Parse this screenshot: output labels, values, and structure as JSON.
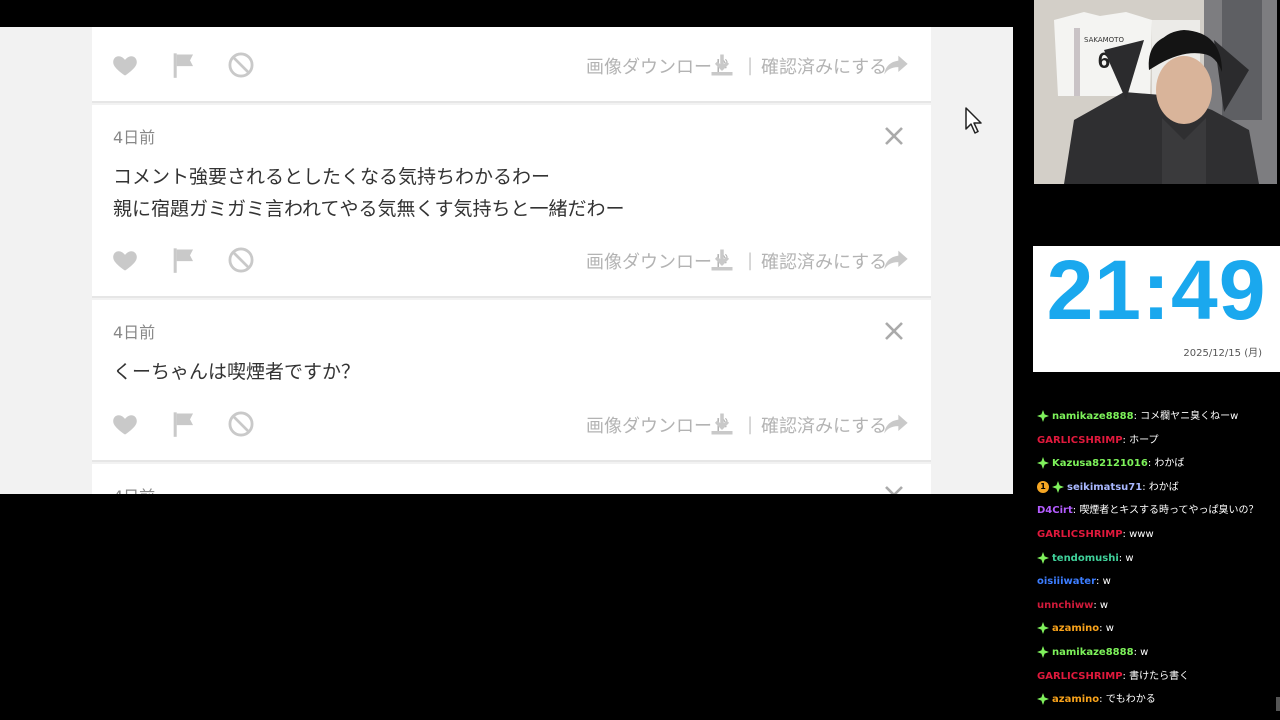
{
  "feed": {
    "actions": {
      "download_label": "画像ダウンロード",
      "separator": "|",
      "confirm_label": "確認済みにする"
    },
    "comments": [
      {
        "date": "",
        "lines": []
      },
      {
        "date": "4日前",
        "lines": [
          "コメント強要されるとしたくなる気持ちわかるわー",
          "親に宿題ガミガミ言われてやる気無くす気持ちと一緒だわー"
        ]
      },
      {
        "date": "4日前",
        "lines": [
          "くーちゃんは喫煙者ですか？"
        ]
      },
      {
        "date": "4日前",
        "lines": []
      }
    ]
  },
  "clock": {
    "time": "21:49",
    "date": "2025/12/15 (月)",
    "color": "#1aa8ee"
  },
  "webcam": {
    "jersey_name": "SAKAMOTO",
    "jersey_number": "6"
  },
  "chat": {
    "messages": [
      {
        "user": "namikaze8888",
        "color": "#7df25a",
        "badge": "diamond",
        "text": "コメ欄ヤニ臭くねーw"
      },
      {
        "user": "GARLICSHRIMP",
        "color": "#e0193c",
        "badge": "",
        "text": "ホープ"
      },
      {
        "user": "Kazusa82121016",
        "color": "#7df25a",
        "badge": "diamond",
        "text": "わかば"
      },
      {
        "user": "seikimatsu71",
        "color": "#a9b8ff",
        "badge": "coin-diamond",
        "coin": "1",
        "text": "わかば"
      },
      {
        "user": "D4Cirt",
        "color": "#b45cff",
        "badge": "",
        "text": "喫煙者とキスする時ってやっぱ臭いの？"
      },
      {
        "user": "GARLICSHRIMP",
        "color": "#e0193c",
        "badge": "",
        "text": "www"
      },
      {
        "user": "tendomushi",
        "color": "#3fd19a",
        "badge": "diamond",
        "text": "w"
      },
      {
        "user": "oisiiiwater",
        "color": "#3c7dff",
        "badge": "",
        "text": "w"
      },
      {
        "user": "unnchiww",
        "color": "#d11a3a",
        "badge": "",
        "text": "w"
      },
      {
        "user": "azamino",
        "color": "#f7a21b",
        "badge": "diamond",
        "text": "w"
      },
      {
        "user": "namikaze8888",
        "color": "#7df25a",
        "badge": "diamond",
        "text": "w"
      },
      {
        "user": "GARLICSHRIMP",
        "color": "#e0193c",
        "badge": "",
        "text": "書けたら書く"
      },
      {
        "user": "azamino",
        "color": "#f7a21b",
        "badge": "diamond",
        "text": "でもわかる"
      }
    ]
  }
}
